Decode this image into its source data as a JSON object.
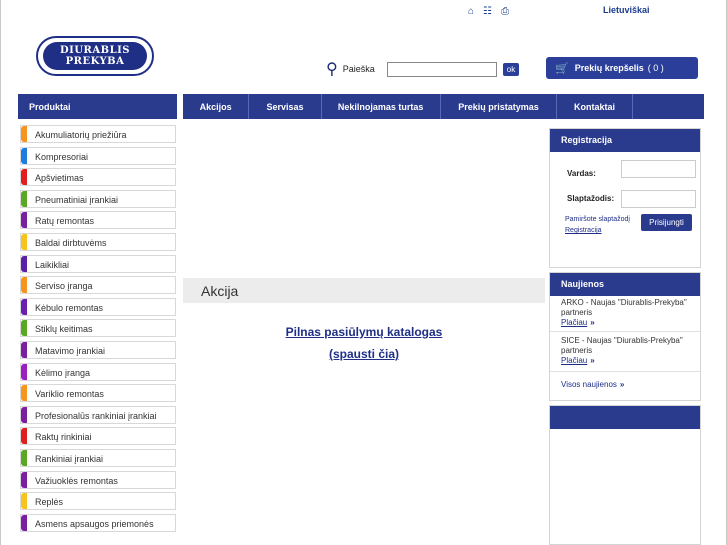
{
  "header": {
    "icons": [
      "home-icon",
      "sitemap-icon",
      "print-icon"
    ],
    "language": "Lietuviškai",
    "logo_line1": "DIURABLIS",
    "logo_line2": "PREKYBA"
  },
  "search": {
    "label": "Paieška",
    "placeholder": "",
    "button": "ok"
  },
  "cart": {
    "label": "Prekių krepšelis",
    "count": "( 0 )"
  },
  "sidebar": {
    "title": "Produktai",
    "items": [
      {
        "label": "Akumuliatorių priežiūra",
        "color": "#f7941d"
      },
      {
        "label": "Kompresoriai",
        "color": "#1e7be0"
      },
      {
        "label": "Apšvietimas",
        "color": "#e01e1e"
      },
      {
        "label": "Pneumatiniai įrankiai",
        "color": "#5aa822"
      },
      {
        "label": "Ratų remontas",
        "color": "#7a1fa2"
      },
      {
        "label": "Baldai dirbtuvėms",
        "color": "#f7c31d"
      },
      {
        "label": "Laikikliai",
        "color": "#5a1fa8"
      },
      {
        "label": "Serviso įranga",
        "color": "#f7941d"
      },
      {
        "label": "Kėbulo remontas",
        "color": "#6a1fb0"
      },
      {
        "label": "Stiklų keitimas",
        "color": "#5aa822"
      },
      {
        "label": "Matavimo įrankiai",
        "color": "#7a1fa2"
      },
      {
        "label": "Kėlimo įranga",
        "color": "#9a1fc0"
      },
      {
        "label": "Variklio remontas",
        "color": "#f7941d"
      },
      {
        "label": "Profesionalūs rankiniai įrankiai",
        "color": "#7a1fa2"
      },
      {
        "label": "Raktų rinkiniai",
        "color": "#e01e1e"
      },
      {
        "label": "Rankiniai įrankiai",
        "color": "#5aa822"
      },
      {
        "label": "Važiuoklės remontas",
        "color": "#7a1fa2"
      },
      {
        "label": "Replės",
        "color": "#f7c31d"
      },
      {
        "label": "Asmens apsaugos priemonės",
        "color": "#7a1fa2"
      }
    ]
  },
  "nav": {
    "items": [
      "Akcijos",
      "Servisas",
      "Nekilnojamas turtas",
      "Prekių pristatymas",
      "Kontaktai"
    ]
  },
  "main": {
    "section_title": "Akcija",
    "catalog_line1": "Pilnas  pasiūlymų katalogas",
    "catalog_line2": "(spausti čia)"
  },
  "registration": {
    "title": "Registracija",
    "name_label": "Vardas:",
    "password_label": "Slaptažodis:",
    "forgot_link": "Pamiršote slaptažodį",
    "register_link": "Registracija",
    "login_button": "Prisijungti"
  },
  "news": {
    "title": "Naujienos",
    "items": [
      {
        "text": "ARKO - Naujas \"Diurablis-Prekyba\" partneris",
        "more": "Plačiau"
      },
      {
        "text": "SICE - Naujas \"Diurablis-Prekyba\" partneris",
        "more": "Plačiau"
      }
    ],
    "all_link": "Visos naujienos"
  }
}
